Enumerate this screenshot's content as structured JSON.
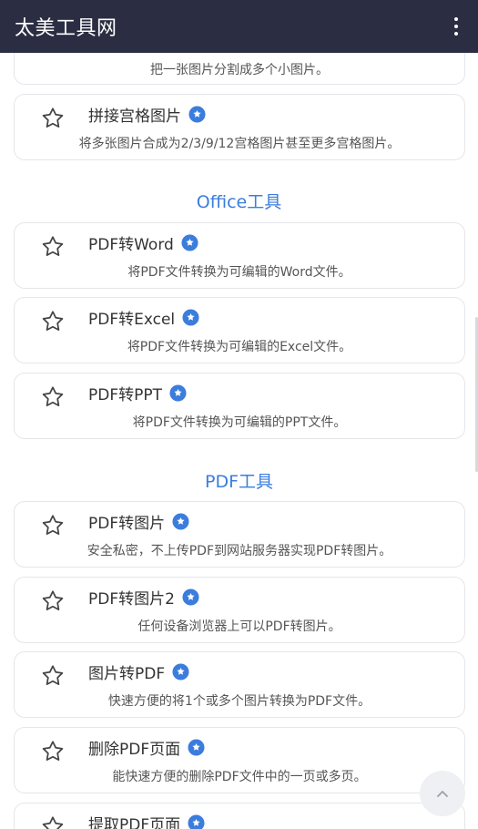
{
  "appbar": {
    "title": "太美工具网"
  },
  "cards": [
    {
      "title": "",
      "desc": "把一张图片分割成多个小图片。"
    },
    {
      "title": "拼接宫格图片",
      "desc": "将多张图片合成为2/3/9/12宫格图片甚至更多宫格图片。"
    },
    {
      "title": "PDF转Word",
      "desc": "将PDF文件转换为可编辑的Word文件。"
    },
    {
      "title": "PDF转Excel",
      "desc": "将PDF文件转换为可编辑的Excel文件。"
    },
    {
      "title": "PDF转PPT",
      "desc": "将PDF文件转换为可编辑的PPT文件。"
    },
    {
      "title": "PDF转图片",
      "desc": "安全私密，不上传PDF到网站服务器实现PDF转图片。"
    },
    {
      "title": "PDF转图片2",
      "desc": "任何设备浏览器上可以PDF转图片。"
    },
    {
      "title": "图片转PDF",
      "desc": "快速方便的将1个或多个图片转换为PDF文件。"
    },
    {
      "title": "删除PDF页面",
      "desc": "能快速方便的删除PDF文件中的一页或多页。"
    },
    {
      "title": "提取PDF页面",
      "desc": ""
    }
  ],
  "sections": [
    {
      "title": "Office工具"
    },
    {
      "title": "PDF工具"
    }
  ],
  "icons": {
    "favorite": "star-outline-icon",
    "badge": "verified-badge-icon",
    "menu": "more-vertical-icon",
    "back_to_top": "chevron-up-icon"
  },
  "colors": {
    "appbar": "#2b2d42",
    "accent": "#3b7ddd",
    "badge": "#3b7ddd"
  }
}
